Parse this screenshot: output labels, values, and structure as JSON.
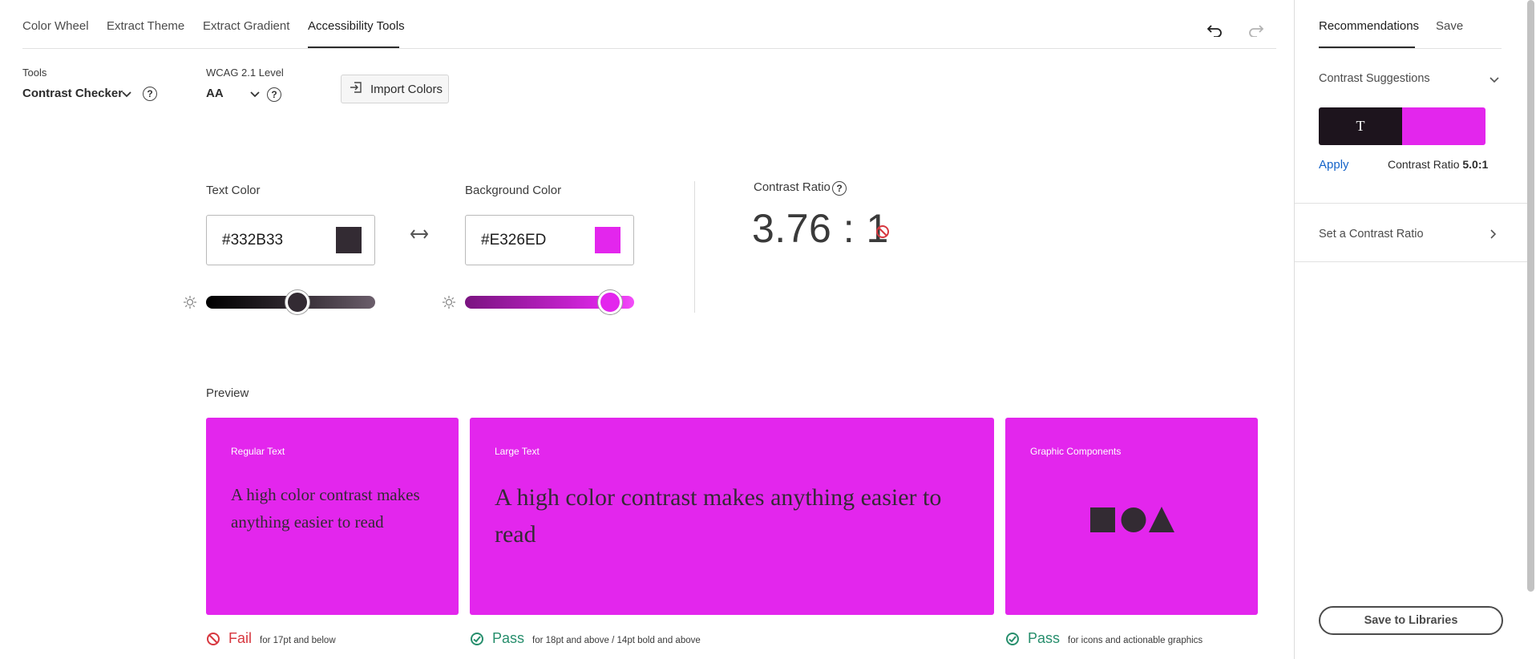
{
  "tabs": [
    "Color Wheel",
    "Extract Theme",
    "Extract Gradient",
    "Accessibility Tools"
  ],
  "active_tab": "Accessibility Tools",
  "toolbar": {
    "undo_icon": "undo-icon",
    "redo_icon": "redo-icon"
  },
  "tools": {
    "label": "Tools",
    "value": "Contrast Checker"
  },
  "wcag": {
    "label": "WCAG 2.1 Level",
    "value": "AA"
  },
  "help_glyph": "?",
  "import_label": "Import Colors",
  "text_color": {
    "label": "Text Color",
    "hex": "#332B33",
    "swatch": "#332B33",
    "slider_level": 0.54
  },
  "background_color": {
    "label": "Background Color",
    "hex": "#E326ED",
    "swatch": "#E326ED",
    "slider_level": 0.86
  },
  "contrast": {
    "label": "Contrast Ratio",
    "value": "3.76 : 1",
    "status": "fail"
  },
  "preview": {
    "title": "Preview",
    "cards": [
      {
        "title": "Regular Text",
        "text": "A high color contrast makes anything easier to read"
      },
      {
        "title": "Large Text",
        "text": "A high color contrast makes anything easier to read"
      },
      {
        "title": "Graphic Components"
      }
    ],
    "results": [
      {
        "status": "Fail",
        "note": "for 17pt and below",
        "color": "#d7373f"
      },
      {
        "status": "Pass",
        "note": "for 18pt and above / 14pt bold and above",
        "color": "#268e6c"
      },
      {
        "status": "Pass",
        "note": "for icons and actionable graphics",
        "color": "#268e6c"
      }
    ]
  },
  "right_panel": {
    "tabs": [
      "Recommendations",
      "Save"
    ],
    "contrast_suggestions": "Contrast Suggestions",
    "suggestion": {
      "text_glyph": "T",
      "text_color": "#1d141d",
      "bg_color": "#E326ED",
      "apply": "Apply",
      "ratio_label": "Contrast Ratio",
      "ratio_value": "5.0:1"
    },
    "set_ratio": "Set a Contrast Ratio",
    "save_to_libraries": "Save to Libraries"
  },
  "colors": {
    "accent_blue": "#1463c8",
    "fail_red": "#d7373f",
    "pass_green": "#268e6c"
  }
}
